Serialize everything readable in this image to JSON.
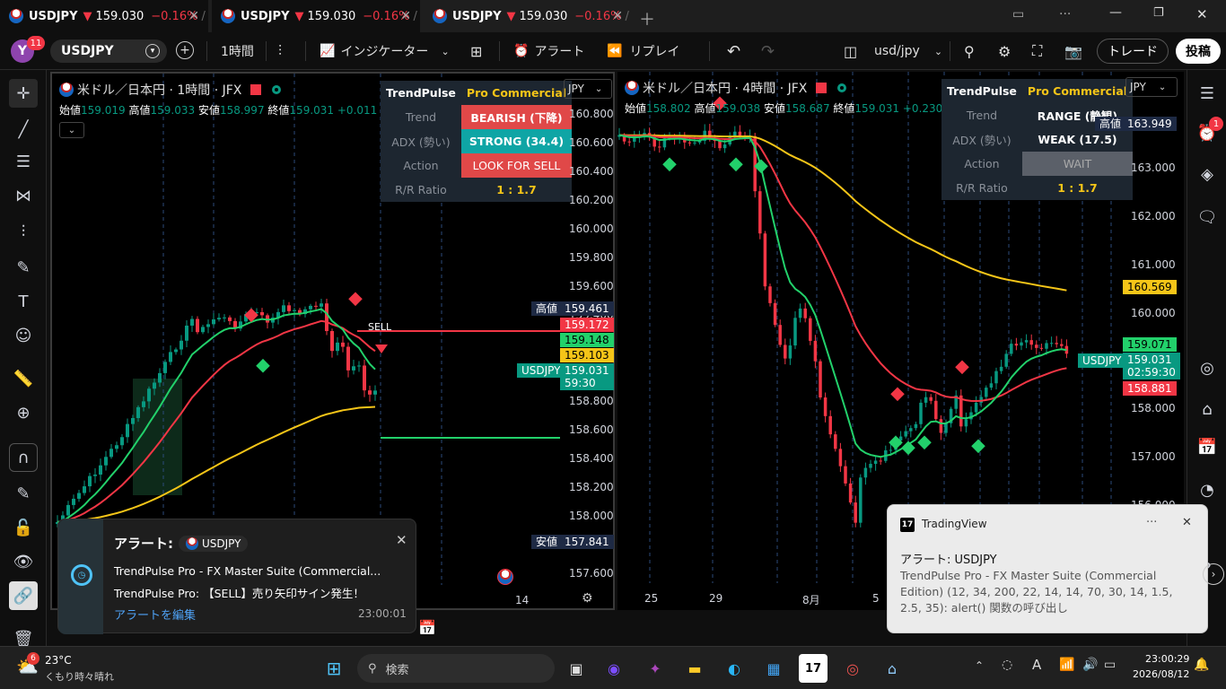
{
  "tabs": [
    {
      "symbol": "USDJPY",
      "arrow": "▼",
      "price": "159.030",
      "change": "−0.16%",
      "sep": "/"
    },
    {
      "symbol": "USDJPY",
      "arrow": "▼",
      "price": "159.030",
      "change": "−0.16%",
      "sep": "/"
    },
    {
      "symbol": "USDJPY",
      "arrow": "▼",
      "price": "159.030",
      "change": "−0.16%",
      "sep": "/"
    }
  ],
  "toolbar": {
    "avatar": "Y",
    "avatar_badge": "11",
    "symbol": "USDJPY",
    "interval": "1時間",
    "indicators": "インジケーター",
    "alert": "アラート",
    "replay": "リプレイ",
    "layout_name": "usd/jpy",
    "trade": "トレード",
    "publish": "投稿"
  },
  "chart1": {
    "title": "米ドル／日本円 · 1時間 · JFX",
    "ohlc_open_l": "始値",
    "ohlc_open": "159.019",
    "ohlc_high_l": "高値",
    "ohlc_high": "159.033",
    "ohlc_low_l": "安値",
    "ohlc_low": "158.997",
    "ohlc_close_l": "終値",
    "ohlc_close": "159.031",
    "ohlc_chg": "+0.011 (+0.01%)",
    "currency": "JPY",
    "panel": {
      "h1": "TrendPulse",
      "h2": "Pro Commercial",
      "rows": [
        [
          "Trend",
          "BEARISH (下降)"
        ],
        [
          "ADX (勢い)",
          "STRONG (34.4)"
        ],
        [
          "Action",
          "LOOK FOR SELL"
        ],
        [
          "R/R Ratio",
          "1 : 1.7"
        ]
      ]
    },
    "axis": [
      "160.800",
      "160.600",
      "160.400",
      "160.200",
      "160.000",
      "159.800",
      "159.600",
      "159.400",
      "159.200",
      "159.000",
      "158.800",
      "158.600",
      "158.400",
      "158.200",
      "158.000",
      "157.800",
      "157.600"
    ],
    "high_l": "高値",
    "high": "159.461",
    "low_l": "安値",
    "low": "157.841",
    "tag_red": "159.172",
    "tag_green": "159.148",
    "tag_yellow": "159.103",
    "sym_tag": "USDJPY",
    "price_tag": "159.031",
    "countdown": "59:30",
    "sell_label": "SELL",
    "x_label": "14"
  },
  "chart2": {
    "title": "米ドル／日本円 · 4時間 · JFX",
    "ohlc_open_l": "始値",
    "ohlc_open": "158.802",
    "ohlc_high_l": "高値",
    "ohlc_high": "159.038",
    "ohlc_low_l": "安値",
    "ohlc_low": "158.687",
    "ohlc_close_l": "終値",
    "ohlc_close": "159.031",
    "ohlc_chg": "+0.230 (+0.14%)",
    "currency": "JPY",
    "panel": {
      "h1": "TrendPulse",
      "h2": "Pro Commercial",
      "rows": [
        [
          "Trend",
          "RANGE (静観)"
        ],
        [
          "ADX (勢い)",
          "WEAK (17.5)"
        ],
        [
          "Action",
          "WAIT"
        ],
        [
          "R/R Ratio",
          "1 : 1.7"
        ]
      ]
    },
    "axis": [
      "163.000",
      "162.000",
      "161.000",
      "160.000",
      "158.000",
      "157.000",
      "156.000"
    ],
    "high_l": "高値",
    "high": "163.949",
    "tag_yellow": "160.569",
    "tag_green": "159.071",
    "sym_tag": "USDJPY",
    "price_tag": "159.031",
    "countdown": "02:59:30",
    "tag_red": "158.881",
    "x_labels": [
      "25",
      "29",
      "8月",
      "5"
    ]
  },
  "alert_popup": {
    "title": "アラート:",
    "symbol": "USDJPY",
    "line1": "TrendPulse Pro - FX Master Suite (Commercial...",
    "line2": "TrendPulse Pro: 【SELL】売り矢印サイン発生！",
    "edit": "アラートを編集",
    "time": "23:00:01"
  },
  "toast": {
    "app": "TradingView",
    "title": "アラート: USDJPY",
    "body": "TrendPulse Pro - FX Master Suite (Commercial Edition) (12, 34, 200, 22, 14, 14, 70, 30, 14, 1.5, 2.5, 35): alert() 関数の呼び出し"
  },
  "taskbar": {
    "temp": "23°C",
    "weather": "くもり時々晴れ",
    "weather_badge": "6",
    "search": "検索",
    "time": "23:00:29",
    "date": "2026/08/12"
  },
  "colors": {
    "up": "#089981",
    "down": "#f23645",
    "green": "#22d16b",
    "panel_red": "#e04848",
    "panel_teal": "#0fa5a5",
    "yellow": "#f5c518"
  }
}
